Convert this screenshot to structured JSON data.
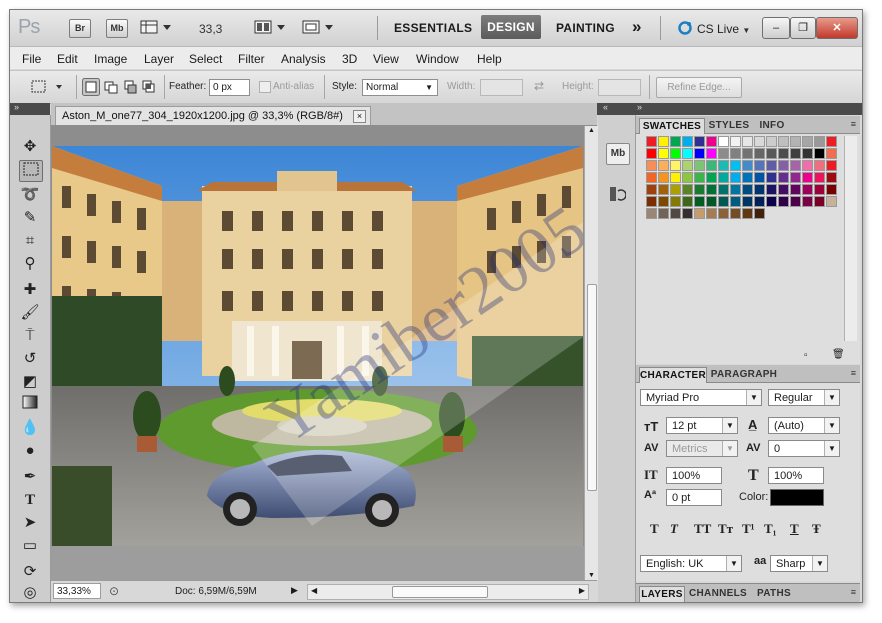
{
  "titlebar": {
    "app_logo": "Ps",
    "bridge_btn": "Br",
    "minibridge_btn": "Mb",
    "zoom": "33,3",
    "workspaces": [
      "ESSENTIALS",
      "DESIGN",
      "PAINTING"
    ],
    "active_workspace": "DESIGN",
    "more": "»",
    "cs_live": "CS Live",
    "icons": [
      "view-extras-icon",
      "arrange-documents-icon",
      "screen-mode-icon",
      "cs-live-icon"
    ]
  },
  "menu": [
    "File",
    "Edit",
    "Image",
    "Layer",
    "Select",
    "Filter",
    "Analysis",
    "3D",
    "View",
    "Window",
    "Help"
  ],
  "options": {
    "feather_label": "Feather:",
    "feather_value": "0 px",
    "antialias_label": "Anti-alias",
    "style_label": "Style:",
    "style_value": "Normal",
    "width_label": "Width:",
    "height_label": "Height:",
    "refine_edge": "Refine Edge..."
  },
  "tools": [
    "move-tool-icon",
    "marquee-tool-icon",
    "lasso-tool-icon",
    "quick-selection-tool-icon",
    "crop-tool-icon",
    "eyedropper-tool-icon",
    "healing-brush-tool-icon",
    "brush-tool-icon",
    "clone-stamp-tool-icon",
    "history-brush-tool-icon",
    "eraser-tool-icon",
    "gradient-tool-icon",
    "blur-tool-icon",
    "dodge-tool-icon",
    "pen-tool-icon",
    "type-tool-icon",
    "path-selection-tool-icon",
    "rectangle-tool-icon",
    "3d-rotate-tool-icon",
    "3d-orbit-tool-icon"
  ],
  "document": {
    "tab_title": "Aston_M_one77_304_1920x1200.jpg @ 33,3% (RGB/8#)",
    "close": "×",
    "watermark": "Yamiber2005"
  },
  "status": {
    "zoom": "33,33%",
    "doc": "Doc: 6,59M/6,59M"
  },
  "swatches_panel": {
    "tabs": [
      "SWATCHES",
      "STYLES",
      "INFO"
    ],
    "active": "SWATCHES",
    "colors": [
      "#ee1c24",
      "#fff100",
      "#00a651",
      "#00aeef",
      "#2e3192",
      "#ec008c",
      "#ffffff",
      "#f2f2f2",
      "#e6e6e6",
      "#d9d9d9",
      "#cccccc",
      "#bfbfbf",
      "#b3b3b3",
      "#a6a6a6",
      "#999999",
      "#ee1c24",
      "#ff0000",
      "#ffff00",
      "#00ff00",
      "#00ffff",
      "#0000ff",
      "#ff00ff",
      "#8c8c8c",
      "#808080",
      "#737373",
      "#666666",
      "#595959",
      "#4d4d4d",
      "#404040",
      "#333333",
      "#000000",
      "#f26c4f",
      "#f68e55",
      "#fbaf5c",
      "#fff467",
      "#acd372",
      "#7cc576",
      "#3bb878",
      "#1abbb4",
      "#00bff3",
      "#438ccb",
      "#5574b9",
      "#605ca8",
      "#855fa8",
      "#a763a8",
      "#f06ea9",
      "#f26d7d",
      "#ed1c24",
      "#f26522",
      "#f7941d",
      "#fff200",
      "#8dc63f",
      "#39b54a",
      "#00a651",
      "#00a99d",
      "#00aeef",
      "#0072bc",
      "#0054a6",
      "#2e3192",
      "#662d91",
      "#92278f",
      "#ec008c",
      "#ed145b",
      "#9e0b0f",
      "#a0410d",
      "#a3620a",
      "#aba000",
      "#598527",
      "#197b30",
      "#007236",
      "#00746b",
      "#0076a3",
      "#004b80",
      "#003471",
      "#1b1464",
      "#440e62",
      "#630460",
      "#9e005d",
      "#9e0039",
      "#790000",
      "#7b2e00",
      "#7d4900",
      "#827b00",
      "#406618",
      "#005e20",
      "#005826",
      "#005952",
      "#005b7f",
      "#003663",
      "#002157",
      "#0d004c",
      "#32004b",
      "#4b0049",
      "#7b0046",
      "#7a0026",
      "#c7b299",
      "#998675",
      "#736357",
      "#534741",
      "#362f2d",
      "#c69c6d",
      "#a67c52",
      "#8c6239",
      "#754c24",
      "#603913",
      "#42210b"
    ]
  },
  "character_panel": {
    "tabs": [
      "CHARACTER",
      "PARAGRAPH"
    ],
    "active": "CHARACTER",
    "font_family": "Myriad Pro",
    "font_style": "Regular",
    "font_size": "12 pt",
    "leading": "(Auto)",
    "kerning": "Metrics",
    "tracking": "0",
    "vertical_scale": "100%",
    "horizontal_scale": "100%",
    "baseline_shift": "0 pt",
    "color_label": "Color:",
    "color_value": "#000000",
    "format_buttons": [
      "T",
      "T",
      "TT",
      "Tт",
      "T¹",
      "T₁",
      "T",
      "Ŧ"
    ],
    "language": "English: UK",
    "aa_icon": "aa",
    "antialias": "Sharp"
  },
  "bottom_panel": {
    "tabs": [
      "LAYERS",
      "CHANNELS",
      "PATHS"
    ],
    "active": "LAYERS"
  }
}
